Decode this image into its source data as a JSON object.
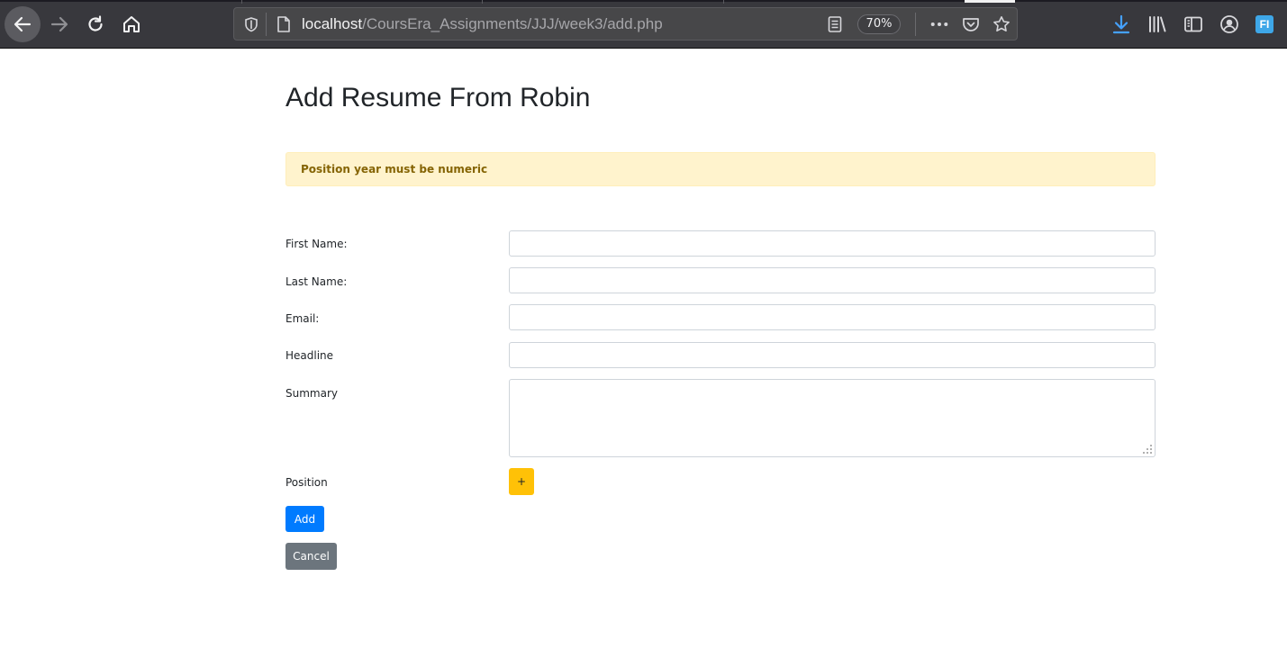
{
  "browser": {
    "url_host": "localhost",
    "url_path": "/CoursEra_Assignments/JJJ/week3/add.php",
    "zoom": "70%",
    "profile_badge": "FI",
    "icons": [
      "back-arrow-icon",
      "forward-arrow-icon",
      "reload-icon",
      "home-icon",
      "shield-icon",
      "page-icon",
      "reader-view-icon",
      "more-icon",
      "pocket-icon",
      "bookmark-star-icon",
      "download-icon",
      "library-icon",
      "sidebar-icon",
      "account-icon",
      "extension-icon"
    ],
    "accent_color": "#45a1ff"
  },
  "page": {
    "title": "Add Resume From Robin",
    "alert_message": "Position year must be numeric",
    "alert_colors": {
      "background": "#fff3cd",
      "text": "#856404"
    }
  },
  "form": {
    "first_name_label": "First Name:",
    "last_name_label": "Last Name:",
    "email_label": "Email:",
    "headline_label": "Headline",
    "summary_label": "Summary",
    "position_label": "Position",
    "first_name_value": "",
    "last_name_value": "",
    "email_value": "",
    "headline_value": "",
    "summary_value": "",
    "add_position_label": "+",
    "add_label": "Add",
    "cancel_label": "Cancel",
    "colors": {
      "add": "#007bff",
      "cancel": "#6c757d",
      "add_position": "#ffc107"
    }
  }
}
